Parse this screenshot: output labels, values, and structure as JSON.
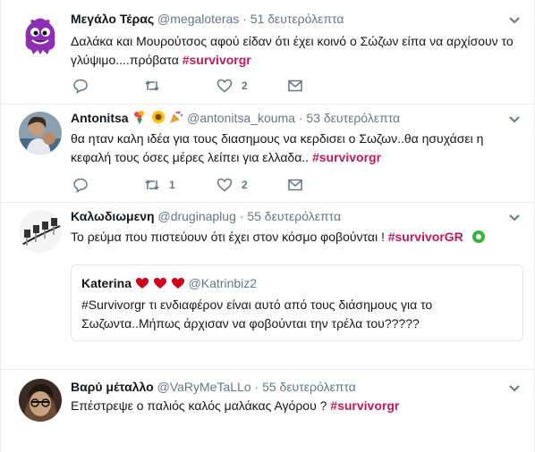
{
  "tweets": [
    {
      "name": "Μεγάλο Τέρας",
      "handle": "@megaloteras",
      "time": "51 δευτερόλεπτα",
      "text": "Δαλάκα και Μουρούτσος αφού είδαν ότι έχει κοινό ο Σώζων είπα να αρχίσουν το γλύψιμο....πρόβατα",
      "hashtag": "#survivorgr",
      "retweets": "",
      "likes": "2"
    },
    {
      "name": "Antonitsa",
      "handle": "@antonitsa_kouma",
      "time": "53 δευτερόλεπτα",
      "text": "θα ηταν καλη ιδέα για τους διασημους να κερδισει ο Σωζων..θα ησυχάσει η κεφαλή τους όσες μέρες λείπει για ελλαδα..",
      "hashtag": "#survivorgr",
      "retweets": "1",
      "likes": "2"
    },
    {
      "name": "Καλωδιωμενη",
      "handle": "@druginaplug",
      "time": "55 δευτερόλεπτα",
      "text": "Το ρεύμα που πιστεύουν ότι έχει στον κόσμο φοβούνται !",
      "hashtag": "#survivorGR",
      "quote": {
        "name": "Katerina",
        "handle": "@Katrinbiz2",
        "text": "#Survivorgr τι ενδιαφέρον είναι αυτό από τους διάσημους για το Σωζωντα..Μήπως άρχισαν να φοβούνται την τρέλα του?????"
      }
    },
    {
      "name": "Βαρύ μέταλλο",
      "handle": "@VaRyMeTaLLo",
      "time": "55 δευτερόλεπτα",
      "text": "Επέστρεψε ο παλιός καλός μαλάκας Αγόρου ?",
      "hashtag": "#survivorgr"
    }
  ],
  "separator": "·",
  "colors": {
    "hashtag": "#c4185b",
    "secondary": "#657786",
    "border": "#e6ecf0"
  }
}
